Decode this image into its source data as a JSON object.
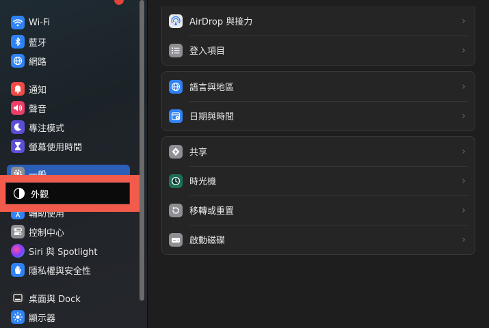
{
  "sidebar": {
    "items": [
      {
        "label": "Wi-Fi"
      },
      {
        "label": "藍牙"
      },
      {
        "label": "網路"
      },
      {
        "label": "通知"
      },
      {
        "label": "聲音"
      },
      {
        "label": "專注模式"
      },
      {
        "label": "螢幕使用時間"
      },
      {
        "label": "一般"
      },
      {
        "label": "外觀"
      },
      {
        "label": "輔助使用"
      },
      {
        "label": "控制中心"
      },
      {
        "label": "Siri 與 Spotlight"
      },
      {
        "label": "隱私權與安全性"
      },
      {
        "label": "桌面與 Dock"
      },
      {
        "label": "顯示器"
      }
    ],
    "selected": "一般"
  },
  "main": {
    "groups": [
      {
        "rows": [
          {
            "label": "AirDrop 與接力"
          },
          {
            "label": "登入項目"
          }
        ]
      },
      {
        "rows": [
          {
            "label": "語言與地區"
          },
          {
            "label": "日期與時間"
          }
        ]
      },
      {
        "rows": [
          {
            "label": "共享"
          },
          {
            "label": "時光機"
          },
          {
            "label": "移轉或重置"
          },
          {
            "label": "啟動磁碟"
          }
        ]
      }
    ]
  },
  "colors": {
    "accent": "#2b5fb8",
    "annotation": "#f25b4c"
  }
}
